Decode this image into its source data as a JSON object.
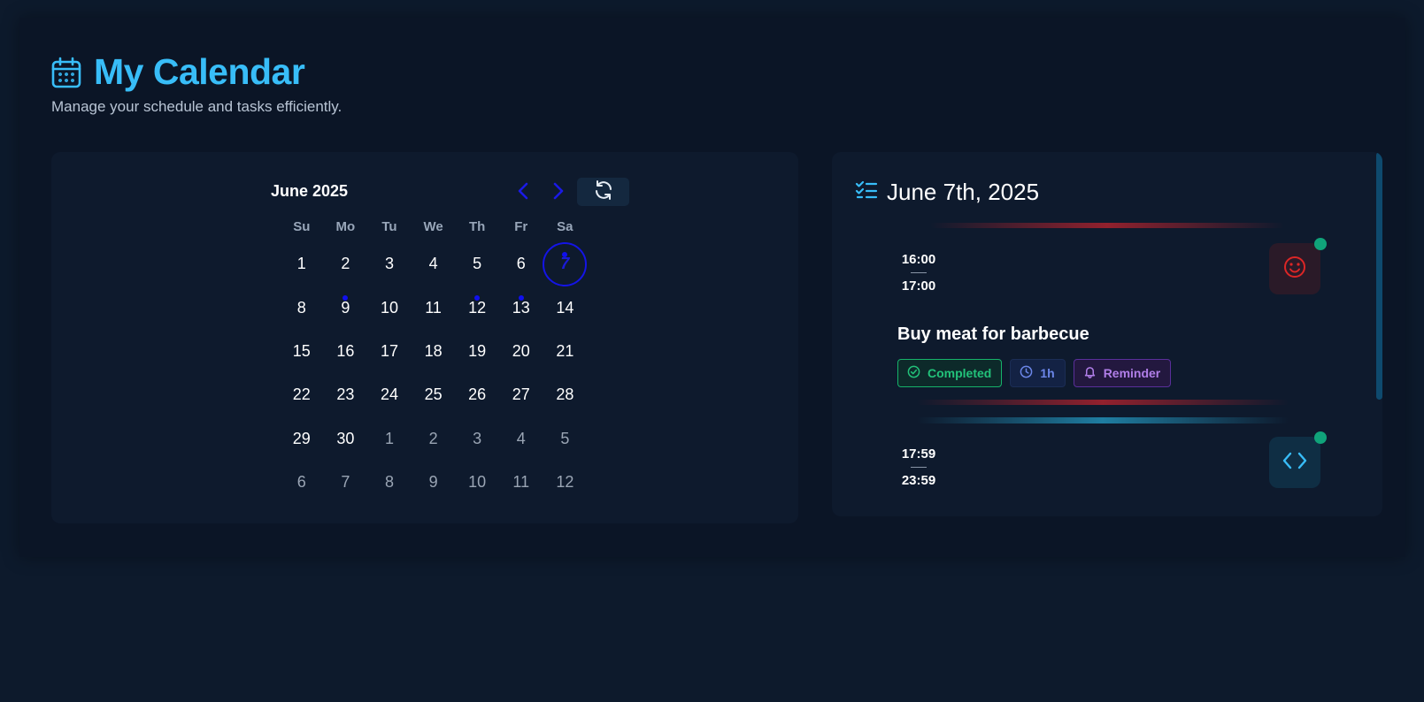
{
  "header": {
    "title": "My Calendar",
    "subtitle": "Manage your schedule and tasks efficiently.",
    "icon": "calendar-icon",
    "accent": "#38bdf8"
  },
  "calendar": {
    "month_label": "June 2025",
    "prev_icon": "chevron-left-icon",
    "next_icon": "chevron-right-icon",
    "refresh_icon": "refresh-icon",
    "weekdays": [
      "Su",
      "Mo",
      "Tu",
      "We",
      "Th",
      "Fr",
      "Sa"
    ],
    "weeks": [
      [
        {
          "d": "1"
        },
        {
          "d": "2"
        },
        {
          "d": "3"
        },
        {
          "d": "4"
        },
        {
          "d": "5"
        },
        {
          "d": "6"
        },
        {
          "d": "7",
          "selected": true,
          "dot": true
        }
      ],
      [
        {
          "d": "8"
        },
        {
          "d": "9",
          "dot": true
        },
        {
          "d": "10"
        },
        {
          "d": "11"
        },
        {
          "d": "12",
          "dot": true
        },
        {
          "d": "13",
          "dot": true
        },
        {
          "d": "14"
        }
      ],
      [
        {
          "d": "15"
        },
        {
          "d": "16"
        },
        {
          "d": "17"
        },
        {
          "d": "18"
        },
        {
          "d": "19"
        },
        {
          "d": "20"
        },
        {
          "d": "21"
        }
      ],
      [
        {
          "d": "22"
        },
        {
          "d": "23"
        },
        {
          "d": "24"
        },
        {
          "d": "25"
        },
        {
          "d": "26"
        },
        {
          "d": "27"
        },
        {
          "d": "28"
        }
      ],
      [
        {
          "d": "29"
        },
        {
          "d": "30"
        },
        {
          "d": "1",
          "muted": true
        },
        {
          "d": "2",
          "muted": true
        },
        {
          "d": "3",
          "muted": true
        },
        {
          "d": "4",
          "muted": true
        },
        {
          "d": "5",
          "muted": true
        }
      ],
      [
        {
          "d": "6",
          "muted": true
        },
        {
          "d": "7",
          "muted": true
        },
        {
          "d": "8",
          "muted": true
        },
        {
          "d": "9",
          "muted": true
        },
        {
          "d": "10",
          "muted": true
        },
        {
          "d": "11",
          "muted": true
        },
        {
          "d": "12",
          "muted": true
        }
      ]
    ],
    "selected_color": "#1414e6"
  },
  "schedule": {
    "date_title": "June 7th, 2025",
    "title_icon": "checklist-icon",
    "events": [
      {
        "start": "16:00",
        "end": "17:00",
        "title": "Buy meat for barbecue",
        "icon": "smile-icon",
        "tags": {
          "status": "Completed",
          "duration": "1h",
          "reminder": "Reminder"
        }
      },
      {
        "start": "17:59",
        "end": "23:59",
        "icon": "code-icon"
      }
    ]
  }
}
